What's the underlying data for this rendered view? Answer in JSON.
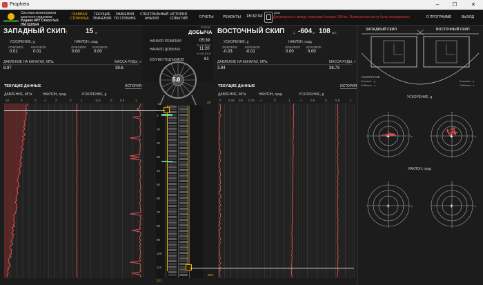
{
  "window": {
    "title": "Propheto",
    "minimize": "–",
    "maximize": "☐",
    "close": "✕"
  },
  "brand": {
    "line1": "Система мониторинга",
    "line2": "шахтного подъемка",
    "line3": "Рудник 4РУ Ствол №5 ПМ ЦШ5х4"
  },
  "nav": {
    "items": [
      {
        "label": "ГЛАВНАЯ СТРАНИЦА",
        "active": true
      },
      {
        "label": "ТЕКУЩИЕ ЗНАЧЕНИЯ",
        "active": false
      },
      {
        "label": "ЗНАЧЕНИЯ ПО ГЛУБИНЕ",
        "active": false
      },
      {
        "label": "СПЕКТРАЛЬНЫЙ АНАЛИЗ",
        "active": false
      },
      {
        "label": "ИСТОРИЯ СОБЫТИЙ",
        "active": false
      },
      {
        "label": "ОТЧЕТЫ",
        "active": false
      },
      {
        "label": "РЕМОНТЫ",
        "active": false
      }
    ],
    "time": "16:32:04",
    "alert_code": "3004",
    "alert_text": "Длительность между пакетами больше 100 мс. Вычисления могут быть некорректны",
    "about": "О ПРОГРАММЕ",
    "exit": "ВЫХОД"
  },
  "west": {
    "title": "ЗАПАДНЫЙ СКИП",
    "value": "15",
    "unit": "м",
    "accel_label": "УСКОРЕНИЕ, g",
    "tilt_label": "НАКЛОН, град",
    "lobovoe": "ЛОБОВОЕ",
    "bokovoe": "БОКОВОЕ",
    "accel_lob": "0.01",
    "accel_bok": "0.01",
    "tilt_lob": "0.00",
    "tilt_bok": "0.00",
    "pressure_label": "ДАВЛЕНИЕ НА КАНАТАХ, МПа",
    "pressure": "8.97",
    "mass_label": "МАССА РУДЫ, т",
    "mass": "39.6"
  },
  "center": {
    "status_label": "Статус",
    "status": "ДОБЫЧА",
    "rev_label": "НАЧАЛО РЕВИЗИИ",
    "rev_time": "05:39",
    "rev_date": "24.09.2018",
    "prod_label": "НАЧАЛО ДОБЫЧИ",
    "prod_time": "11:20",
    "prod_date": "24.09.2018",
    "lifts_label": "КОЛ-ВО ПОДЪЕМОВ",
    "lifts": "61",
    "speed": "5.0"
  },
  "east": {
    "title": "ВОСТОЧНЫЙ СКИП",
    "value": "-604",
    "unit": "м",
    "value2": "108",
    "unit2": "м/с",
    "accel_label": "УСКОРЕНИЕ, g",
    "tilt_label": "НАКЛОН, град",
    "lobovoe": "ЛОБОВОЕ",
    "bokovoe": "БОКОВОЕ",
    "accel_lob": "-0.03",
    "accel_bok": "-0.01",
    "tilt_lob": "0.00",
    "tilt_bok": "0.00",
    "pressure_label": "ДАВЛЕНИЕ НА КАНАТАХ, МПа",
    "pressure": "3.94",
    "mass_label": "МАССА РУДЫ, т",
    "mass": "38.73"
  },
  "current": {
    "title": "ТЕКУЩИЕ ДАННЫЕ",
    "history": "ИСТОРИЯ",
    "pressure": "ДАВЛЕНИЕ, МПа",
    "tilt": "НАКЛОН, град",
    "accel": "УСКОРЕНИЕ, g"
  },
  "west_ticks": {
    "p": [
      "10",
      "5",
      "0"
    ],
    "t": [
      "-4",
      "2",
      "0"
    ],
    "a": [
      "1",
      "-0.5",
      "0",
      "0.5",
      "1"
    ]
  },
  "east_ticks": {
    "p": [
      "0",
      "0.25",
      "0.5",
      "0.75"
    ],
    "t": [
      "-1",
      "0",
      "1"
    ],
    "a": [
      "-1",
      "0.5",
      "0",
      "0.5",
      "1"
    ]
  },
  "depth": {
    "ticks": [
      "5",
      "10",
      "20",
      "30",
      "40",
      "50",
      "60",
      "70",
      "80",
      "90",
      "100",
      "110"
    ],
    "top": "0",
    "top_right": "45",
    "bottom_left": "121",
    "bottom_right": "-634"
  },
  "schematic": {
    "west": "ЗАПАДНЫЙ СКИП",
    "east": "ВОСТОЧНЫЙ СКИП",
    "accel_legend_title": "УСКОРЕНИЕ",
    "accel_legend": [
      "Боковое - y",
      "Лобовое - x"
    ],
    "accel_legend2": [
      "Боковое - y",
      "Лобовое - x"
    ]
  },
  "radar": {
    "accel_title": "УСКОРЕНИЕ, g",
    "tilt_title": "НАКЛОН, град",
    "x": "x",
    "y": "y"
  },
  "colors": {
    "accent": "#f0b400",
    "trace": "#d9534f",
    "alert": "#e33333"
  }
}
